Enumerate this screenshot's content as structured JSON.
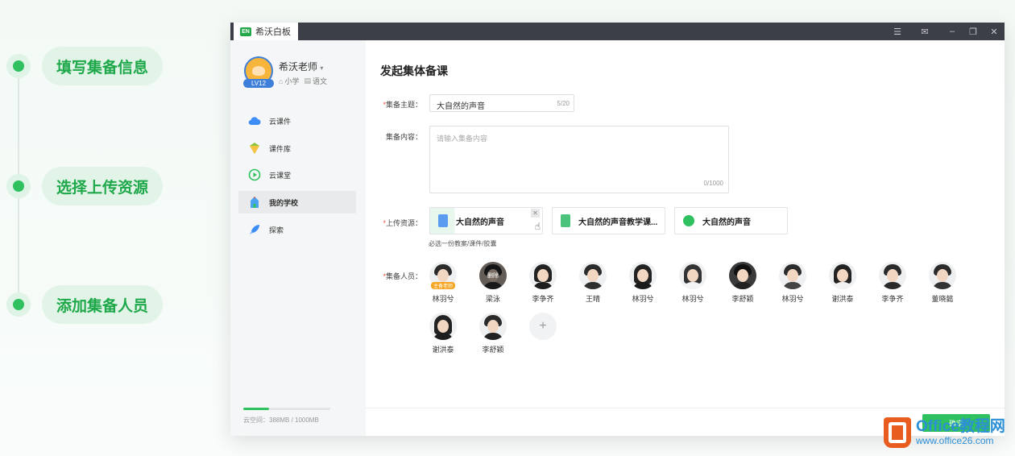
{
  "steps": [
    {
      "label": "填写集备信息"
    },
    {
      "label": "选择上传资源"
    },
    {
      "label": "添加集备人员"
    }
  ],
  "app": {
    "title": "希沃白板",
    "logo_text": "EN"
  },
  "user": {
    "name": "希沃老师",
    "level": "LV12",
    "grade": "小学",
    "subject": "语文"
  },
  "nav": [
    {
      "label": "云课件",
      "icon": "cloud-icon"
    },
    {
      "label": "课件库",
      "icon": "library-icon"
    },
    {
      "label": "云课堂",
      "icon": "play-circle-icon"
    },
    {
      "label": "我的学校",
      "icon": "school-icon",
      "active": true
    },
    {
      "label": "探索",
      "icon": "rocket-icon"
    }
  ],
  "storage": {
    "text": "云空间：388MB / 1000MB",
    "used_fraction": 0.388
  },
  "form": {
    "page_title": "发起集体备课",
    "topic": {
      "label": "集备主题：",
      "value": "大自然的声音",
      "counter": "5/20"
    },
    "content": {
      "label": "集备内容：",
      "placeholder": "请输入集备内容",
      "counter": "0/1000"
    },
    "resources": {
      "label": "上传资源：",
      "hint": "必选一份教案/课件/胶囊",
      "items": [
        {
          "title": "大自然的声音",
          "icon": "doc-icon"
        },
        {
          "title": "大自然的声音教学课...",
          "icon": "lesson-plan-icon"
        },
        {
          "title": "大自然的声音",
          "icon": "capsule-icon"
        }
      ]
    },
    "members": {
      "label": "集备人员：",
      "leader_badge": "主备老师",
      "delete_label": "删除",
      "list": [
        {
          "name": "林羽兮"
        },
        {
          "name": "梁泳"
        },
        {
          "name": "李争齐"
        },
        {
          "name": "王晴"
        },
        {
          "name": "林羽兮"
        },
        {
          "name": "林羽兮"
        },
        {
          "name": "李舒颖"
        },
        {
          "name": "林羽兮"
        },
        {
          "name": "谢洪泰"
        },
        {
          "name": "李争齐"
        },
        {
          "name": "董晓懿"
        },
        {
          "name": "谢洪泰"
        },
        {
          "name": "李舒颖"
        }
      ],
      "add_label": "+"
    },
    "confirm_label": "确定"
  },
  "watermark": {
    "line1": "Office教程网",
    "line2": "www.office26.com"
  },
  "colors": {
    "accent": "#2fc15f",
    "step_text": "#1fa84a"
  }
}
